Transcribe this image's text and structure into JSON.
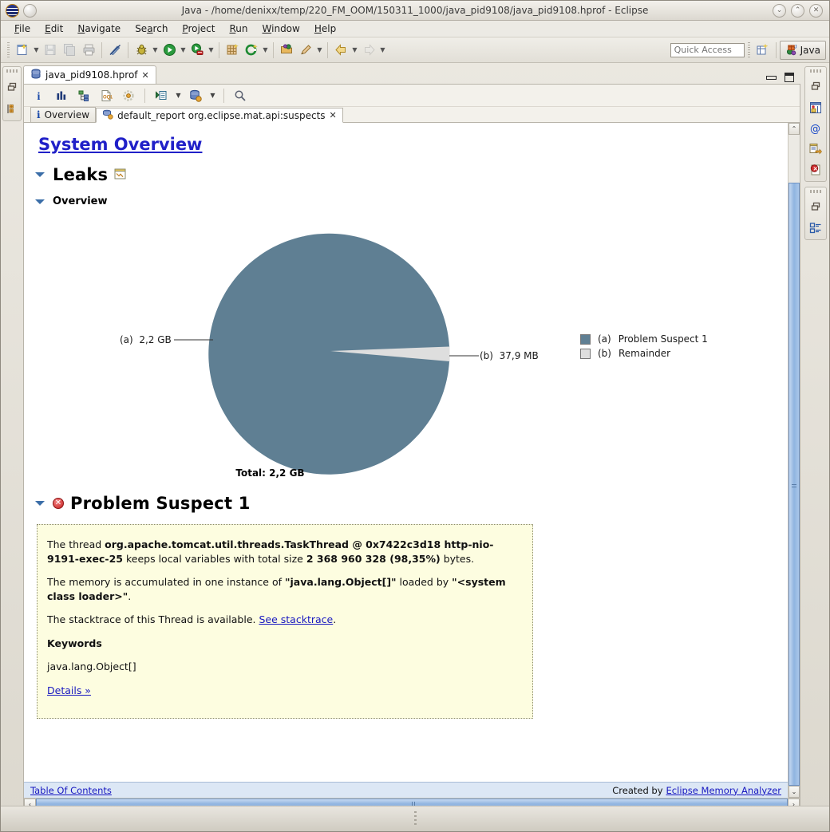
{
  "window": {
    "title": "Java - /home/denixx/temp/220_FM_OOM/150311_1000/java_pid9108/java_pid9108.hprof - Eclipse",
    "minimize_glyph": "⌄",
    "maximize_glyph": "⌃",
    "close_glyph": "✕"
  },
  "menu": [
    {
      "pre": "",
      "mn": "F",
      "post": "ile"
    },
    {
      "pre": "",
      "mn": "E",
      "post": "dit"
    },
    {
      "pre": "",
      "mn": "N",
      "post": "avigate"
    },
    {
      "pre": "Se",
      "mn": "a",
      "post": "rch"
    },
    {
      "pre": "",
      "mn": "P",
      "post": "roject"
    },
    {
      "pre": "",
      "mn": "R",
      "post": "un"
    },
    {
      "pre": "",
      "mn": "W",
      "post": "indow"
    },
    {
      "pre": "",
      "mn": "H",
      "post": "elp"
    }
  ],
  "toolbar": {
    "quick_access_placeholder": "Quick Access",
    "perspective_label": "Java",
    "buttons": [
      "new-wizard-icon",
      "save-icon",
      "save-all-icon",
      "print-icon",
      "toggle-mark-occurrences-icon",
      "debug-icon",
      "run-icon",
      "profile-icon",
      "new-java-package-icon",
      "new-java-class-icon",
      "open-type-icon",
      "search-skip-icon",
      "back-icon",
      "forward-icon"
    ],
    "open_perspective_icon": "open-perspective-icon"
  },
  "left_bar": {
    "restore_icon": "restore-icon",
    "package_explorer_icon": "package-explorer-icon"
  },
  "right_bar": {
    "group_a": [
      "restore-icon",
      "heap-dump-history-icon",
      "at-sign-icon",
      "inspector-icon",
      "error-log-icon"
    ],
    "group_b": [
      "restore-icon",
      "outline-icon"
    ]
  },
  "editor": {
    "tab_label": "java_pid9108.hprof",
    "tab_icon": "heap-dump-icon",
    "tab_close_glyph": "✕",
    "minimize_title": "Minimize",
    "maximize_title": "Maximize"
  },
  "view_toolbar": {
    "buttons": [
      "overview-info-icon",
      "histogram-icon",
      "dominator-tree-icon",
      "oql-icon",
      "query-browser-icon",
      "run-expert-system-icon",
      "open-heapdump-icon",
      "search-icon"
    ]
  },
  "page_tabs": [
    {
      "label": "Overview",
      "icon": "info-icon",
      "active": false,
      "closable": false
    },
    {
      "label": "default_report org.eclipse.mat.api:suspects",
      "icon": "report-icon",
      "active": true,
      "closable": true,
      "close_glyph": "✕"
    }
  ],
  "report": {
    "title": "System Overview",
    "leaks_heading": "Leaks",
    "leaks_icon": "report-page-icon",
    "overview_heading": "Overview",
    "suspect_heading": "Problem Suspect 1",
    "suspect_error_glyph": "✕",
    "suspect": {
      "p1_a": "The thread ",
      "p1_b": "org.apache.tomcat.util.threads.TaskThread @ 0x7422c3d18 http-nio-9191-exec-25",
      "p1_c": " keeps local variables with total size ",
      "p1_d": "2 368 960 328 (98,35%)",
      "p1_e": " bytes.",
      "p2_a": "The memory is accumulated in one instance of ",
      "p2_b": "\"java.lang.Object[]\"",
      "p2_c": " loaded by ",
      "p2_d": "\"<system class loader>\"",
      "p2_e": ".",
      "p3_a": "The stacktrace of this Thread is available. ",
      "p3_link": "See stacktrace",
      "p3_b": ".",
      "keywords_title": "Keywords",
      "keywords_value": "java.lang.Object[]",
      "details_link": "Details »"
    },
    "footer": {
      "toc_link": "Table Of Contents",
      "created_by_label": "Created by",
      "created_by_link": "Eclipse Memory Analyzer"
    }
  },
  "chart_data": {
    "type": "pie",
    "title": "",
    "total_label": "Total: 2,2 GB",
    "categories": [
      "Problem Suspect 1",
      "Remainder"
    ],
    "labels": [
      "(a)",
      "(b)"
    ],
    "values": [
      2368960328,
      39741440
    ],
    "value_labels": [
      "2,2 GB",
      "37,9 MB"
    ],
    "percentages": [
      98.35,
      1.65
    ],
    "colors": [
      "#5f7f93",
      "#dedede"
    ],
    "legend_entries": [
      {
        "key": "(a)",
        "label": "Problem Suspect 1",
        "color": "#5f7f93"
      },
      {
        "key": "(b)",
        "label": "Remainder",
        "color": "#dedede"
      }
    ],
    "legend_position": "right",
    "grid": false,
    "callouts": [
      {
        "key": "(a)",
        "text": "2,2 GB",
        "side": "left"
      },
      {
        "key": "(b)",
        "text": "37,9 MB",
        "side": "right"
      }
    ]
  },
  "scrollbars": {
    "v_up_glyph": "⌃",
    "v_down_glyph": "⌄",
    "h_left_glyph": "‹",
    "h_right_glyph": "›"
  }
}
